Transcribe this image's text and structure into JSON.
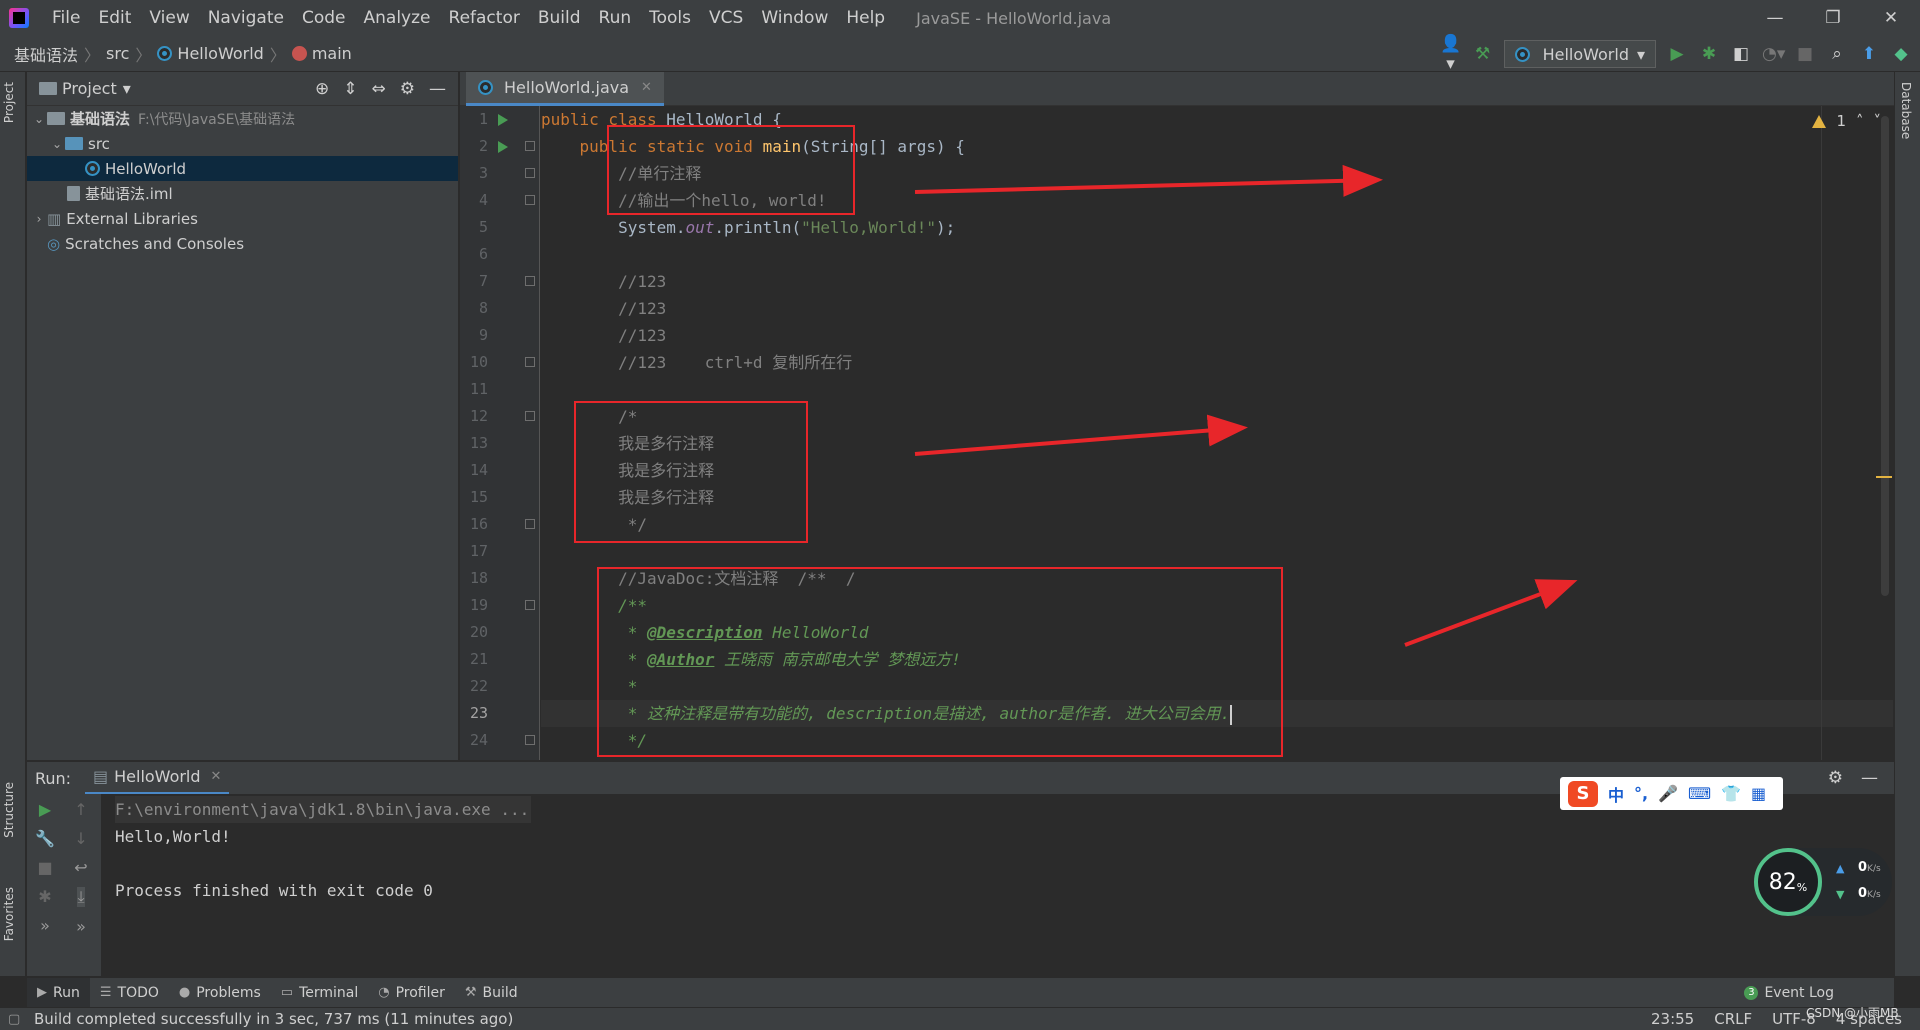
{
  "titlebar": {
    "menu": [
      "File",
      "Edit",
      "View",
      "Navigate",
      "Code",
      "Analyze",
      "Refactor",
      "Build",
      "Run",
      "Tools",
      "VCS",
      "Window",
      "Help"
    ],
    "window_title": "JavaSE - HelloWorld.java",
    "controls": [
      "—",
      "❐",
      "✕"
    ]
  },
  "navbar": {
    "breadcrumb": [
      "基础语法",
      "src",
      "HelloWorld",
      "main"
    ],
    "run_config": "HelloWorld"
  },
  "side": {
    "left_tabs": [
      "Project",
      "Structure",
      "Favorites"
    ],
    "right_tabs": [
      "Database"
    ]
  },
  "project": {
    "title": "Project",
    "tree": [
      {
        "label": "基础语法",
        "hint": "F:\\代码\\JavaSE\\基础语法",
        "indent": 0,
        "arrow": "⌄"
      },
      {
        "label": "src",
        "hint": "",
        "indent": 1,
        "arrow": "⌄"
      },
      {
        "label": "HelloWorld",
        "hint": "",
        "indent": 2,
        "arrow": ""
      },
      {
        "label": "基础语法.iml",
        "hint": "",
        "indent": 1,
        "arrow": ""
      },
      {
        "label": "External Libraries",
        "hint": "",
        "indent": 0,
        "arrow": "›"
      },
      {
        "label": "Scratches and Consoles",
        "hint": "",
        "indent": 0,
        "arrow": ""
      }
    ]
  },
  "editor": {
    "tab": "HelloWorld.java",
    "warnings": "1",
    "current_line": 23,
    "lines": [
      "1",
      "2",
      "3",
      "4",
      "5",
      "6",
      "7",
      "8",
      "9",
      "10",
      "11",
      "12",
      "13",
      "14",
      "15",
      "16",
      "17",
      "18",
      "19",
      "20",
      "21",
      "22",
      "23",
      "24"
    ],
    "code": {
      "l1": [
        "public class ",
        "HelloWorld {"
      ],
      "l2": [
        "    public static void ",
        "main",
        "(String[] args) {"
      ],
      "l3": "        //单行注释",
      "l4": "        //输出一个hello, world!",
      "l5": [
        "        System.",
        "out",
        ".println(",
        "\"Hello,World!\"",
        ");"
      ],
      "l7": "        //123",
      "l8": "        //123",
      "l9": "        //123",
      "l10": "        //123    ctrl+d 复制所在行",
      "l12": "        /*",
      "l13": "        我是多行注释",
      "l14": "        我是多行注释",
      "l15": "        我是多行注释",
      "l16": "         */",
      "l18": "        //JavaDoc:文档注释  /**  /",
      "l19": "        /**",
      "l20": [
        "         * ",
        "@Description",
        " HelloWorld"
      ],
      "l21": [
        "         * ",
        "@Author",
        " 王晓雨 南京邮电大学 梦想远方!"
      ],
      "l22": "         *",
      "l23": "         * 这种注释是带有功能的, description是描述, author是作者. 进大公司会用.",
      "l24": "         */"
    }
  },
  "run": {
    "label": "Run:",
    "tab": "HelloWorld",
    "console": [
      "F:\\environment\\java\\jdk1.8\\bin\\java.exe ...",
      "Hello,World!",
      "",
      "Process finished with exit code 0"
    ]
  },
  "ime": {
    "items": [
      "中",
      "°,",
      "🎤",
      "⌨",
      "👕",
      "▦"
    ]
  },
  "net": {
    "percent": "82",
    "unit": "%",
    "up": "0",
    "down": "0",
    "speed_unit": "K/s"
  },
  "bottom_tabs": [
    "Run",
    "TODO",
    "Problems",
    "Terminal",
    "Profiler",
    "Build"
  ],
  "event_log": {
    "count": "3",
    "label": "Event Log"
  },
  "status": {
    "message": "Build completed successfully in 3 sec, 737 ms (11 minutes ago)",
    "position": "23:55",
    "line_sep": "CRLF",
    "encoding": "UTF-8",
    "indent": "4 spaces",
    "watermark": "CSDN @小雨MB"
  },
  "colors": {
    "annotation_red": "#e8262a",
    "accent": "#4a88c7"
  }
}
